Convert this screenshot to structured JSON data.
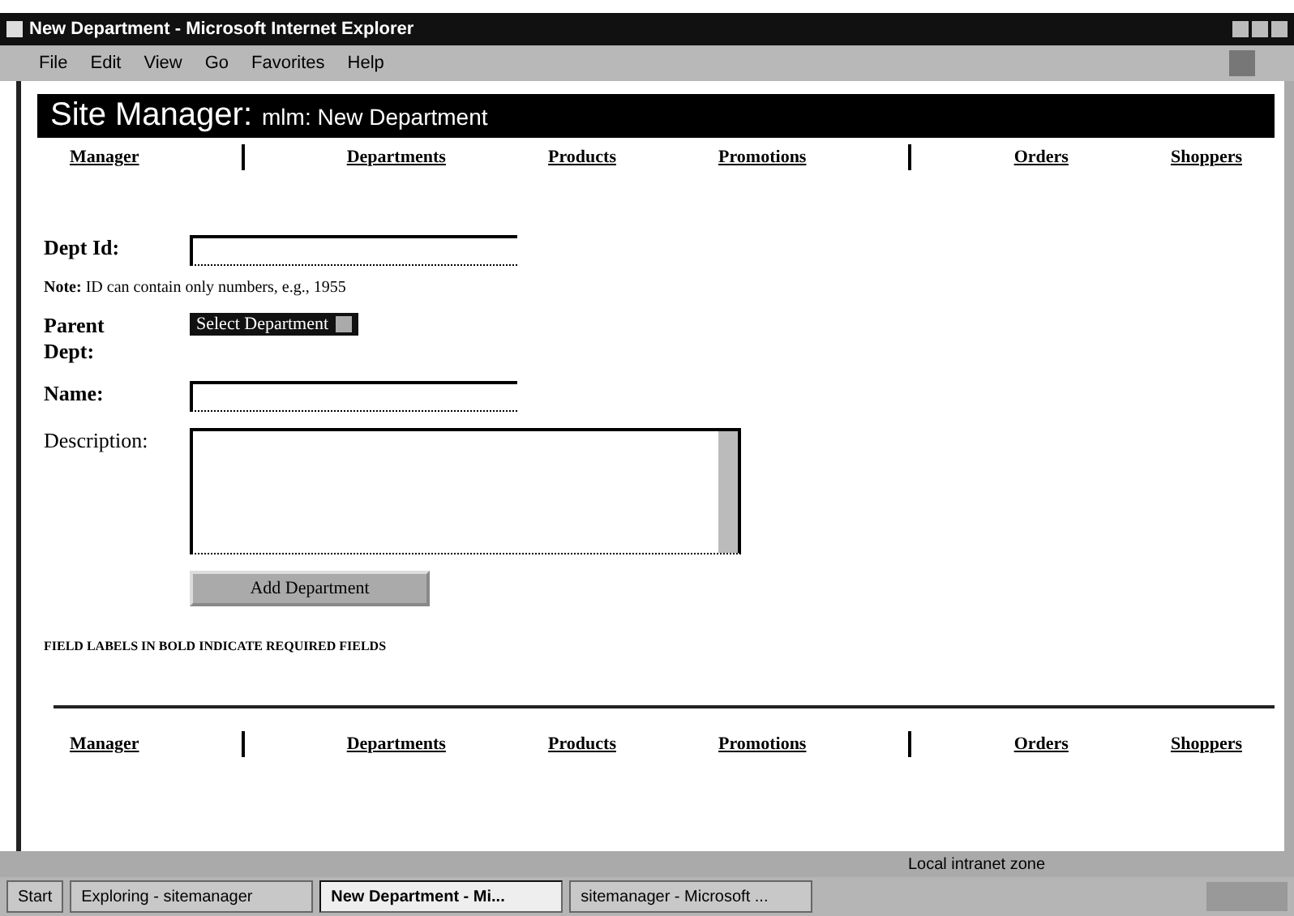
{
  "window": {
    "title": "New Department - Microsoft Internet Explorer"
  },
  "menu": [
    "File",
    "Edit",
    "View",
    "Go",
    "Favorites",
    "Help"
  ],
  "header": {
    "title": "Site Manager:",
    "subtitle": "mlm: New Department"
  },
  "nav_top": [
    {
      "label": "Manager",
      "divider_after": true
    },
    {
      "label": "Departments",
      "divider_after": false
    },
    {
      "label": "Products",
      "divider_after": false
    },
    {
      "label": "Promotions",
      "divider_after": true
    },
    {
      "label": "Orders",
      "divider_after": false
    },
    {
      "label": "Shoppers",
      "divider_after": false
    }
  ],
  "form": {
    "dept_id_label": "Dept Id:",
    "note": "**Note:** ID can contain only numbers, e.g., 1955",
    "parent_label": "Parent Dept:",
    "parent_value": "Select Department",
    "name_label": "Name:",
    "description_label": "Description:",
    "submit": "Add Department",
    "required_note": "FIELD LABELS IN BOLD INDICATE REQUIRED FIELDS"
  },
  "nav_bottom": [
    {
      "label": "Manager",
      "divider_after": true
    },
    {
      "label": "Departments",
      "divider_after": false
    },
    {
      "label": "Products",
      "divider_after": false
    },
    {
      "label": "Promotions",
      "divider_after": true
    },
    {
      "label": "Orders",
      "divider_after": false
    },
    {
      "label": "Shoppers",
      "divider_after": false
    }
  ],
  "status_bar": {
    "zone": "Local intranet zone"
  },
  "taskbar": {
    "start": "Start",
    "tasks": [
      {
        "label": "Exploring - sitemanager",
        "selected": false
      },
      {
        "label": "New Department - Mi...",
        "selected": true
      },
      {
        "label": "sitemanager - Microsoft ...",
        "selected": false
      }
    ]
  }
}
